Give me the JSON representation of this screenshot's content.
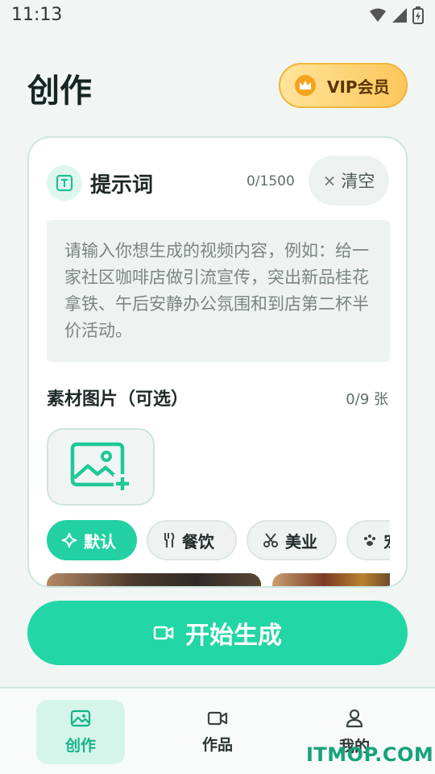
{
  "status_bar": {
    "time": "11:13",
    "icons": [
      "wifi-icon",
      "signal-icon",
      "battery-icon"
    ]
  },
  "header": {
    "title": "创作",
    "vip_label": "VIP会员"
  },
  "prompt": {
    "title": "提示词",
    "char_count": "0/1500",
    "clear_label": "清空",
    "placeholder": "请输入你想生成的视频内容，例如：给一家社区咖啡店做引流宣传，突出新品桂花拿铁、午后安静办公氛围和到店第二杯半价活动。"
  },
  "material": {
    "title": "素材图片（可选）",
    "count": "0/9 张"
  },
  "categories": [
    {
      "label": "默认",
      "icon": "sparkle-icon",
      "active": true
    },
    {
      "label": "餐饮",
      "icon": "fork-knife-icon",
      "active": false
    },
    {
      "label": "美业",
      "icon": "scissors-icon",
      "active": false
    },
    {
      "label": "宠",
      "icon": "paw-icon",
      "active": false
    }
  ],
  "start_button_label": "开始生成",
  "bottom_nav": [
    {
      "label": "创作",
      "icon": "image-icon",
      "active": true
    },
    {
      "label": "作品",
      "icon": "video-icon",
      "active": false
    },
    {
      "label": "我的",
      "icon": "user-icon",
      "active": false
    }
  ],
  "watermark": "ITMOP.COM",
  "colors": {
    "accent": "#22d6a5",
    "vip_gold": "#fbc65b",
    "background": "#f1f5f4"
  }
}
